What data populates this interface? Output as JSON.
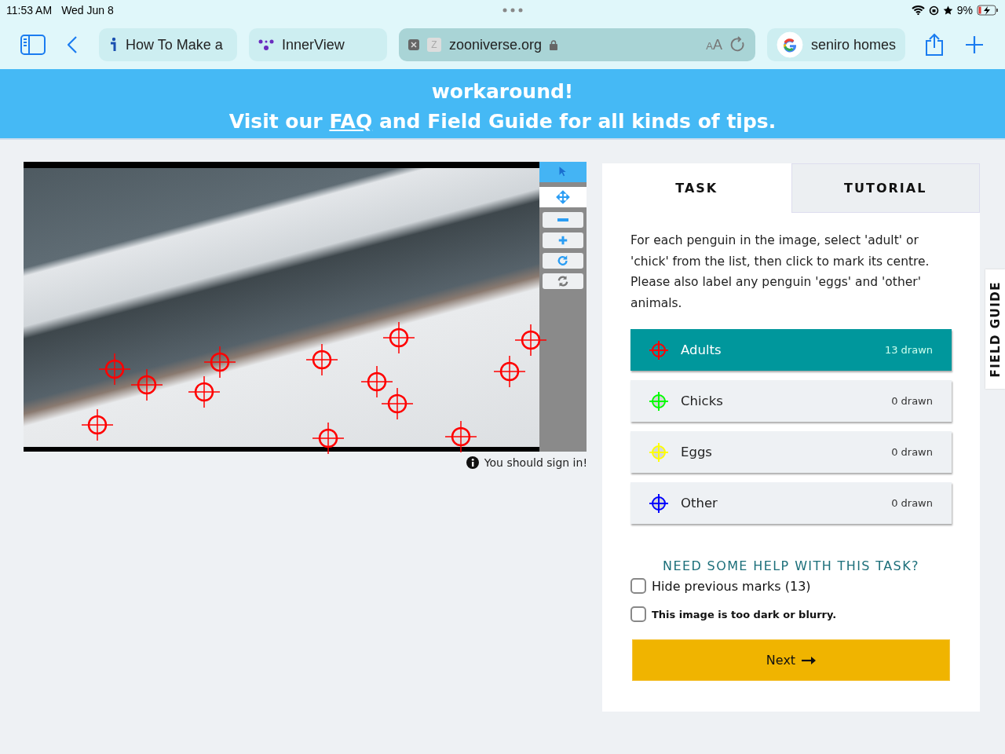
{
  "status_bar": {
    "time": "11:53 AM",
    "date": "Wed Jun 8",
    "battery": "9%"
  },
  "browser": {
    "tabs": [
      {
        "kind": "page",
        "title": "How To Make a"
      },
      {
        "kind": "page2",
        "title": "InnerView"
      },
      {
        "kind": "address",
        "favicon": "Z",
        "title": "zooniverse.org",
        "reader": "AA"
      },
      {
        "kind": "google",
        "title": "seniro homes"
      }
    ]
  },
  "banner": {
    "line1": "workaround!",
    "before": "Visit our ",
    "link": "FAQ",
    "after": " and Field Guide for all kinds of tips."
  },
  "viewer": {
    "tools": [
      {
        "kind": "pointer",
        "selected": true
      },
      {
        "kind": "move",
        "selected": false
      },
      {
        "kind": "zoom-out",
        "selected": false
      },
      {
        "kind": "zoom-in",
        "selected": false
      },
      {
        "kind": "rotate",
        "selected": false
      },
      {
        "kind": "reset",
        "selected": false
      }
    ],
    "note": "You should sign in!"
  },
  "task_panel": {
    "tabs": [
      {
        "label": "TASK",
        "selected": true
      },
      {
        "label": "TUTORIAL",
        "selected": false
      }
    ],
    "instruction": "For each penguin in the image, select 'adult' or 'chick' from the list, then click to mark its centre. Please also label any penguin 'eggs' and 'other' animals.",
    "tools": [
      {
        "label": "Adults",
        "count": "13 drawn",
        "color": "#ff0000",
        "selected": true
      },
      {
        "label": "Chicks",
        "count": "0 drawn",
        "color": "#00ff00",
        "selected": false
      },
      {
        "label": "Eggs",
        "count": "0 drawn",
        "color": "#ffff00",
        "selected": false
      },
      {
        "label": "Other",
        "count": "0 drawn",
        "color": "#0000ff",
        "selected": false
      }
    ],
    "help": "NEED SOME HELP WITH THIS TASK?",
    "checkboxes": [
      {
        "kind": "plain",
        "label": "Hide previous marks (13)",
        "checked": false
      },
      {
        "kind": "bold",
        "label": "This image is too dark or blurry.",
        "checked": false
      }
    ],
    "next_button": "Next"
  },
  "field_guide": "FIELD GUIDE"
}
